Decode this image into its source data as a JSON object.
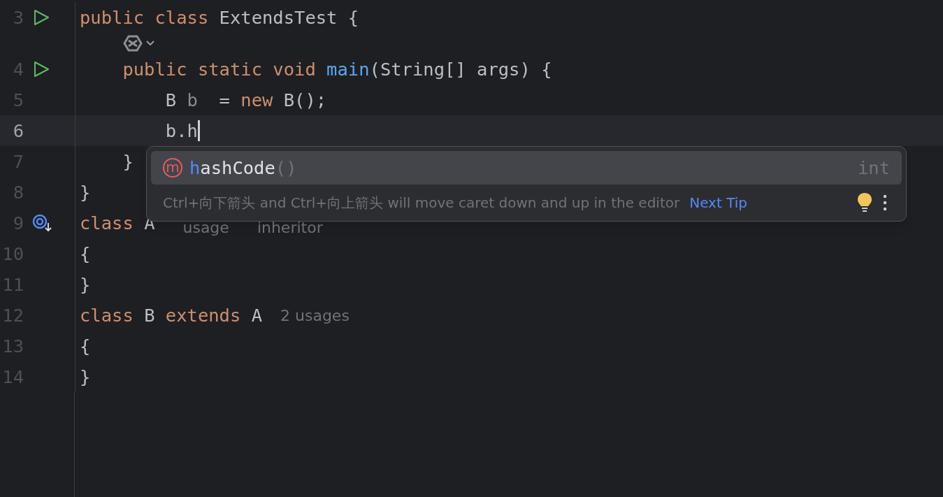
{
  "editor": {
    "lines": [
      {
        "kind": "code",
        "number": "3",
        "current": false,
        "runnable": true,
        "tokens": [
          {
            "kind": "keyword",
            "text": "public class "
          },
          {
            "kind": "plain",
            "text": "ExtendsTest {"
          }
        ]
      },
      {
        "kind": "inlay"
      },
      {
        "kind": "code",
        "number": "4",
        "current": false,
        "runnable": true,
        "tokens": [
          {
            "kind": "keyword",
            "text": "    public static void "
          },
          {
            "kind": "method",
            "text": "main"
          },
          {
            "kind": "plain",
            "text": "(String[] args) {"
          }
        ]
      },
      {
        "kind": "code",
        "number": "5",
        "current": false,
        "tokens": [
          {
            "kind": "plain",
            "text": "        B "
          },
          {
            "kind": "unused",
            "text": "b"
          },
          {
            "kind": "plain",
            "text": "  = "
          },
          {
            "kind": "keyword",
            "text": "new"
          },
          {
            "kind": "plain",
            "text": " B();"
          }
        ]
      },
      {
        "kind": "code",
        "number": "6",
        "current": true,
        "caret": true,
        "tokens": [
          {
            "kind": "plain",
            "text": "        b.h"
          }
        ]
      },
      {
        "kind": "code",
        "number": "7",
        "current": false,
        "tokens": [
          {
            "kind": "plain",
            "text": "    }"
          }
        ]
      },
      {
        "kind": "code",
        "number": "8",
        "current": false,
        "tokens": [
          {
            "kind": "plain",
            "text": "}"
          }
        ]
      },
      {
        "kind": "code",
        "number": "9",
        "current": false,
        "implemented": true,
        "tokens": [
          {
            "kind": "keyword",
            "text": "class "
          },
          {
            "kind": "plain",
            "text": "A"
          },
          {
            "kind": "covered-hint",
            "text": "usage"
          },
          {
            "kind": "covered-hint",
            "text": "inheritor"
          }
        ]
      },
      {
        "kind": "code",
        "number": "10",
        "current": false,
        "tokens": [
          {
            "kind": "plain",
            "text": "{"
          }
        ]
      },
      {
        "kind": "code",
        "number": "11",
        "current": false,
        "tokens": [
          {
            "kind": "plain",
            "text": "}"
          }
        ]
      },
      {
        "kind": "code",
        "number": "12",
        "current": false,
        "tokens": [
          {
            "kind": "keyword",
            "text": "class "
          },
          {
            "kind": "plain",
            "text": "B "
          },
          {
            "kind": "keyword",
            "text": "extends "
          },
          {
            "kind": "plain",
            "text": "A"
          },
          {
            "kind": "hint",
            "text": "2 usages"
          }
        ]
      },
      {
        "kind": "code",
        "number": "13",
        "current": false,
        "tokens": [
          {
            "kind": "plain",
            "text": "{"
          }
        ]
      },
      {
        "kind": "code",
        "number": "14",
        "current": false,
        "tokens": [
          {
            "kind": "plain",
            "text": "}"
          }
        ]
      }
    ]
  },
  "completion": {
    "items": [
      {
        "icon": "m",
        "match": "h",
        "rest": "ashCode",
        "params": "()",
        "type": "int",
        "selected": true
      }
    ],
    "tip": {
      "text": "Ctrl+向下箭头 and Ctrl+向上箭头 will move caret down and up in the editor",
      "link": "Next Tip"
    }
  }
}
